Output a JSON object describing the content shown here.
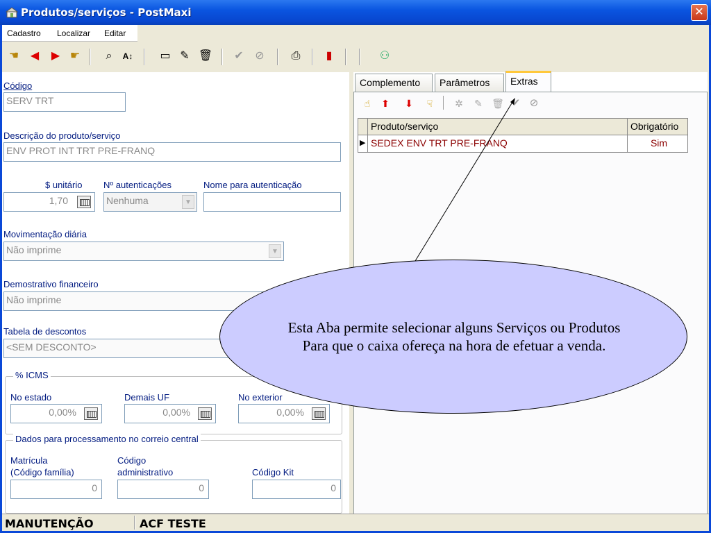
{
  "window": {
    "title": "Produtos/serviços - PostMaxi",
    "close_label": "✕"
  },
  "menu": {
    "items": [
      "Cadastro",
      "Localizar",
      "Editar"
    ]
  },
  "toolbar": {
    "icons": [
      "first-icon",
      "prev-icon",
      "next-icon",
      "last-icon",
      "search-icon",
      "sort-icon",
      "new-icon",
      "edit-icon",
      "delete-icon",
      "confirm-icon",
      "cancel-icon",
      "print-icon",
      "exit-icon",
      "users-icon"
    ]
  },
  "form": {
    "codigo_label": "Código",
    "codigo_value": "SERV TRT",
    "descricao_label": "Descrição do produto/serviço",
    "descricao_value": "ENV PROT INT TRT PRE-FRANQ",
    "unitario_label": "$ unitário",
    "unitario_value": "1,70",
    "autenticacoes_label": "Nº autenticações",
    "autenticacoes_value": "Nenhuma",
    "nome_autenticacao_label": "Nome para autenticação",
    "nome_autenticacao_value": "",
    "movimentacao_label": "Movimentação diária",
    "movimentacao_value": "Não imprime",
    "demonstrativo_label": "Demostrativo financeiro",
    "demonstrativo_value": "Não imprime",
    "tabela_label": "Tabela de descontos",
    "tabela_value": "<SEM DESCONTO>",
    "icms_group": "% ICMS",
    "no_estado_label": "No estado",
    "no_estado_value": "0,00%",
    "demais_uf_label": "Demais UF",
    "demais_uf_value": "0,00%",
    "no_exterior_label": "No exterior",
    "no_exterior_value": "0,00%",
    "correio_group": "Dados para processamento no correio central",
    "matricula_label_1": "Matrícula",
    "matricula_label_2": "(Código família)",
    "matricula_value": "0",
    "codigo_adm_label_1": "Código",
    "codigo_adm_label_2": "administrativo",
    "codigo_adm_value": "0",
    "codigo_kit_label": "Código Kit",
    "codigo_kit_value": "0"
  },
  "tabs": {
    "complemento": "Complemento",
    "parametros": "Parâmetros",
    "extras": "Extras"
  },
  "extras": {
    "icons": [
      "grab-icon",
      "arrow-up-icon",
      "arrow-down-icon",
      "pointer-icon",
      "new-icon",
      "edit-icon",
      "delete-icon",
      "confirm-icon",
      "cancel-icon"
    ],
    "columns": [
      "Produto/serviço",
      "Obrigatório"
    ],
    "rows": [
      {
        "produto": "SEDEX ENV TRT PRE-FRANQ",
        "obrigatorio": "Sim"
      }
    ]
  },
  "status": {
    "mode": "MANUTENÇÃO",
    "user": "ACF TESTE"
  },
  "callout": {
    "line1": "Esta Aba permite selecionar alguns Serviços ou Produtos",
    "line2": "Para que o caixa ofereça na hora de efetuar a venda."
  }
}
